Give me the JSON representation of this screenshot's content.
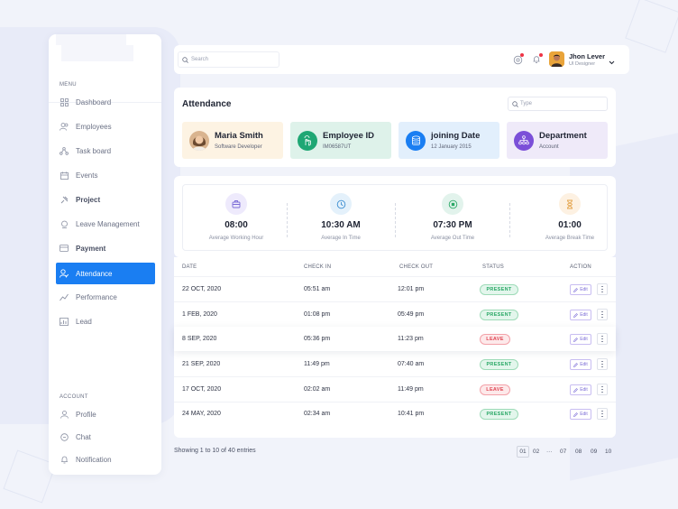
{
  "search": {
    "placeholder": "Search"
  },
  "user": {
    "name": "Jhon Lever",
    "role": "UI Designer"
  },
  "sidebar": {
    "menu_heading": "MENU",
    "account_heading": "ACCOUNT",
    "items": [
      {
        "label": "Dashboard",
        "icon": "dashboard-icon"
      },
      {
        "label": "Employees",
        "icon": "users-icon"
      },
      {
        "label": "Task board",
        "icon": "taskboard-icon"
      },
      {
        "label": "Events",
        "icon": "calendar-icon"
      },
      {
        "label": "Project",
        "icon": "project-icon"
      },
      {
        "label": "Leave Management",
        "icon": "leave-icon"
      },
      {
        "label": "Payment",
        "icon": "payment-icon"
      },
      {
        "label": "Attendance",
        "icon": "attendance-icon"
      },
      {
        "label": "Performance",
        "icon": "performance-icon"
      },
      {
        "label": "Lead",
        "icon": "lead-icon"
      }
    ],
    "account_items": [
      {
        "label": "Profile",
        "icon": "profile-icon"
      },
      {
        "label": "Chat",
        "icon": "chat-icon"
      },
      {
        "label": "Notification",
        "icon": "notification-icon"
      }
    ]
  },
  "attendance": {
    "title": "Attendance",
    "type_placeholder": "Type",
    "cards": [
      {
        "title": "Maria Smith",
        "sub": "Software Developer",
        "bg": "#fdf3e3",
        "icon": "avatar"
      },
      {
        "title": "Employee ID",
        "sub": "IM06587UT",
        "bg": "#def2ea",
        "icon": "id-icon",
        "color": "#1fa774"
      },
      {
        "title": "joining Date",
        "sub": "12 January 2015",
        "bg": "#e2effc",
        "icon": "database-icon",
        "color": "#1a7ef2"
      },
      {
        "title": "Department",
        "sub": "Account",
        "bg": "#efeaf9",
        "icon": "department-icon",
        "color": "#7b4fd8"
      }
    ]
  },
  "stats": [
    {
      "value": "08:00",
      "label": "Average Working Hour",
      "bg": "#eeeafc",
      "color": "#7b6cd6",
      "icon": "briefcase-icon"
    },
    {
      "value": "10:30 AM",
      "label": "Average In Time",
      "bg": "#e4f1fb",
      "color": "#3a8cd0",
      "icon": "clock-icon"
    },
    {
      "value": "07:30 PM",
      "label": "Average Out Time",
      "bg": "#e2f3ec",
      "color": "#2aa866",
      "icon": "stop-icon"
    },
    {
      "value": "01:00",
      "label": "Average Break Time",
      "bg": "#fdf1e2",
      "color": "#e3a34a",
      "icon": "hourglass-icon"
    }
  ],
  "table": {
    "headers": {
      "date": "DATE",
      "check_in": "CHECK IN",
      "check_out": "CHECK OUT",
      "status": "STATUS",
      "action": "ACTION"
    },
    "edit_label": "Edit",
    "rows": [
      {
        "date": "22 OCT, 2020",
        "check_in": "05:51 am",
        "check_out": "12:01 pm",
        "status": "PRESENT"
      },
      {
        "date": "1 FEB, 2020",
        "check_in": "01:08 pm",
        "check_out": "05:49 pm",
        "status": "PRESENT"
      },
      {
        "date": "8 SEP, 2020",
        "check_in": "05:36 pm",
        "check_out": "11:23 pm",
        "status": "LEAVE"
      },
      {
        "date": "21 SEP, 2020",
        "check_in": "11:49 pm",
        "check_out": "07:40 am",
        "status": "PRESENT"
      },
      {
        "date": "17 OCT, 2020",
        "check_in": "02:02 am",
        "check_out": "11:49 pm",
        "status": "LEAVE"
      },
      {
        "date": "24 MAY, 2020",
        "check_in": "02:34 am",
        "check_out": "10:41 pm",
        "status": "PRESENT"
      }
    ]
  },
  "footer": {
    "entries": "Showing 1 to 10 of 40 entries",
    "pages": [
      "01",
      "02",
      "···",
      "07",
      "08",
      "09",
      "10"
    ],
    "active_page": "01"
  }
}
